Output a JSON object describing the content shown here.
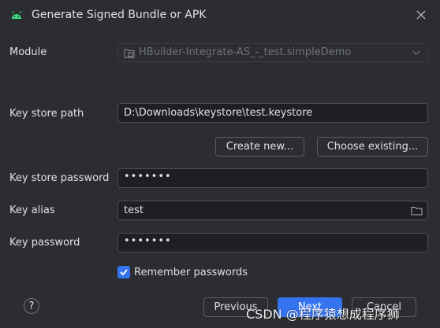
{
  "window": {
    "title": "Generate Signed Bundle or APK"
  },
  "form": {
    "module": {
      "label": "Module",
      "value": "HBuilder-Integrate-AS_-_test.simpleDemo"
    },
    "key_store_path": {
      "label": "Key store path",
      "value": "D:\\Downloads\\keystore\\test.keystore"
    },
    "create_new_label": "Create new...",
    "choose_existing_label": "Choose existing...",
    "key_store_password": {
      "label": "Key store password",
      "value": "•••••••"
    },
    "key_alias": {
      "label": "Key alias",
      "value": "test"
    },
    "key_password": {
      "label": "Key password",
      "value": "•••••••"
    },
    "remember_passwords": {
      "label": "Remember passwords",
      "checked": true
    }
  },
  "footer": {
    "help_label": "?",
    "previous_label": "Previous",
    "next_label": "Next",
    "cancel_label": "Cancel"
  },
  "watermark": "CSDN @程序猿想成程序狮",
  "colors": {
    "background": "#2b2d30",
    "field_background": "#1e1f22",
    "accent": "#3574f0",
    "android_green": "#3ddc84"
  }
}
